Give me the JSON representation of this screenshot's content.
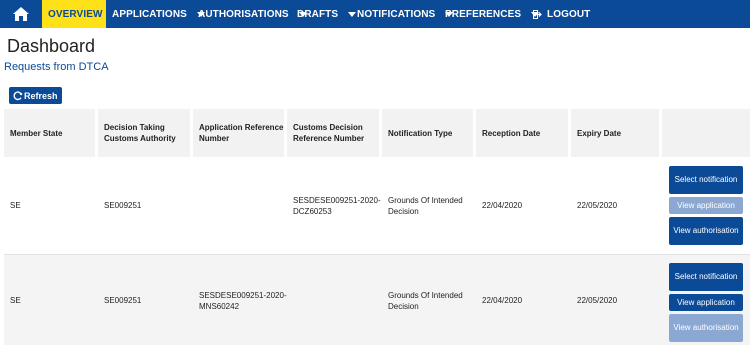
{
  "nav": {
    "items": [
      {
        "label": "OVERVIEW",
        "active": true,
        "caret": true
      },
      {
        "label": "APPLICATIONS",
        "active": false,
        "caret": true
      },
      {
        "label": "AUTHORISATIONS",
        "active": false,
        "caret": true
      },
      {
        "label": "DRAFTS",
        "active": false,
        "caret": true
      },
      {
        "label": "NOTIFICATIONS",
        "active": false,
        "caret": true
      },
      {
        "label": "PREFERENCES",
        "active": false,
        "caret": true
      },
      {
        "label": "LOGOUT",
        "active": false,
        "caret": false
      }
    ],
    "home_icon": "home-icon",
    "logout_icon": "logout-icon"
  },
  "page": {
    "title": "Dashboard",
    "subtitle": "Requests from DTCA",
    "refresh_label": "Refresh"
  },
  "table": {
    "headers": [
      "Member State",
      "Decision Taking Customs Authority",
      "Application Reference Number",
      "Customs Decision Reference Number",
      "Notification Type",
      "Reception Date",
      "Expiry Date",
      ""
    ],
    "rows": [
      {
        "member_state": "SE",
        "dtca": "SE009251",
        "app_ref": "",
        "cd_ref": "SESDESE009251-2020-DCZ60253",
        "notif_type": "Grounds Of Intended Decision",
        "reception": "22/04/2020",
        "expiry": "22/05/2020",
        "actions": [
          {
            "label": "Select notification",
            "enabled": true
          },
          {
            "label": "View application",
            "enabled": false
          },
          {
            "label": "View authorisation",
            "enabled": true
          }
        ]
      },
      {
        "member_state": "SE",
        "dtca": "SE009251",
        "app_ref": "SESDESE009251-2020-MNS60242",
        "cd_ref": "",
        "notif_type": "Grounds Of Intended Decision",
        "reception": "22/04/2020",
        "expiry": "22/05/2020",
        "actions": [
          {
            "label": "Select notification",
            "enabled": true
          },
          {
            "label": "View application",
            "enabled": true
          },
          {
            "label": "View authorisation",
            "enabled": false
          }
        ]
      }
    ]
  },
  "colors": {
    "nav_bg": "#0b4a97",
    "nav_active": "#ffe11a",
    "button": "#0b4a97",
    "button_disabled": "#8ba8d2"
  }
}
